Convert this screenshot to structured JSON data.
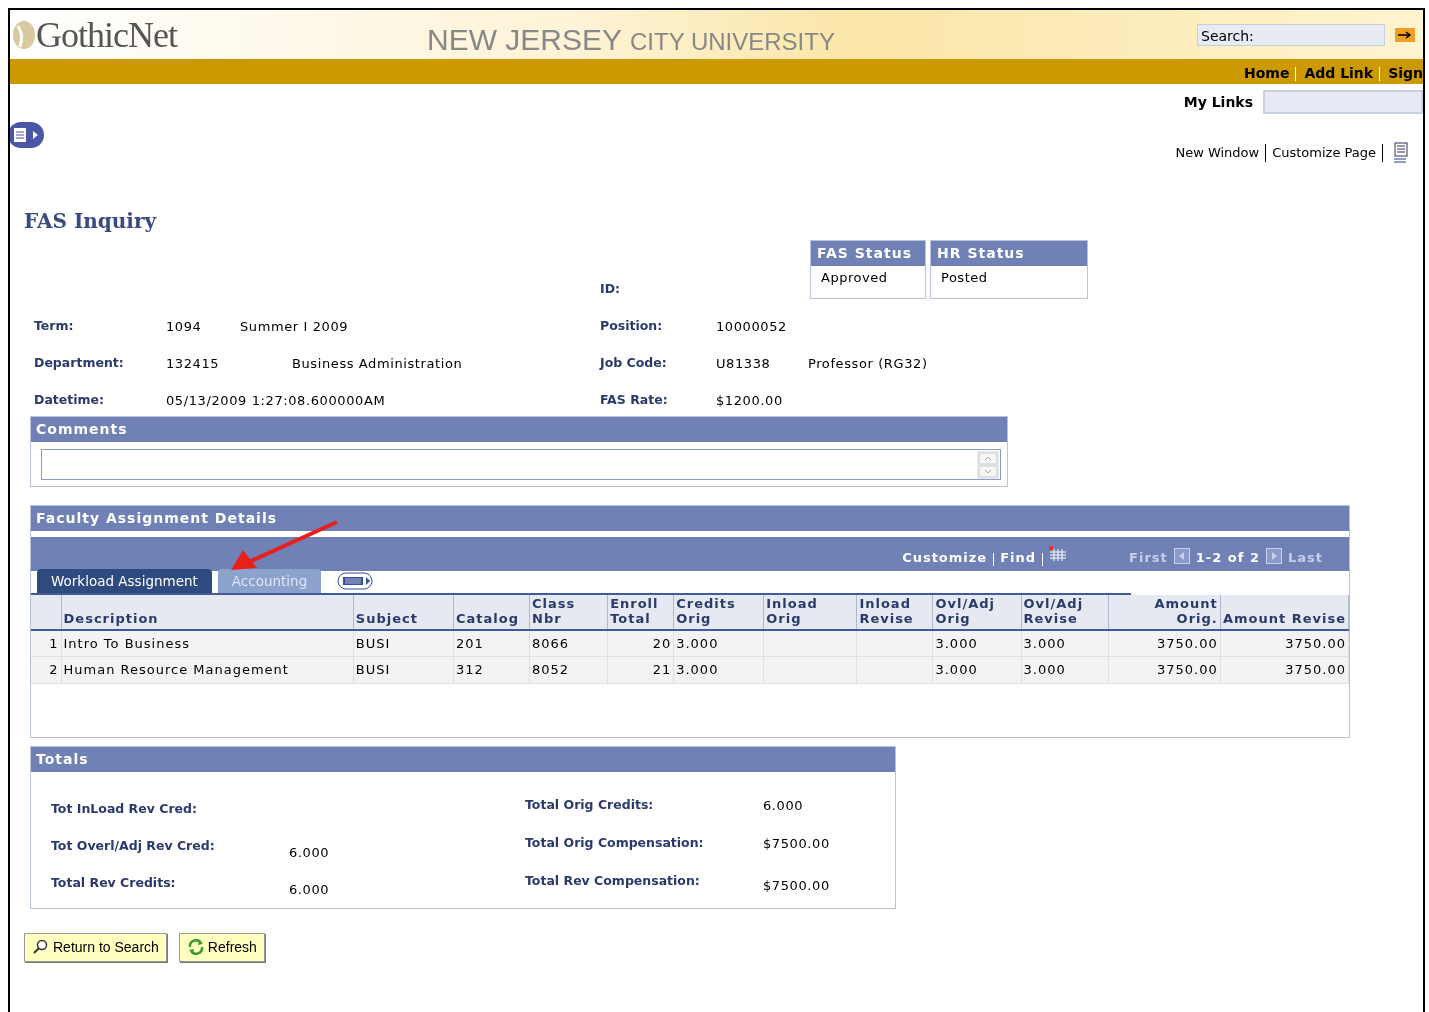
{
  "header": {
    "logo": "GothicNet",
    "university_main": "NEW JERSEY",
    "university_sub": "CITY UNIVERSITY",
    "search_label": "Search:"
  },
  "nav_links": [
    "Home",
    "Add Link",
    "Sign"
  ],
  "my_links": "My Links",
  "page_links": [
    "New Window",
    "Customize Page"
  ],
  "title": "FAS Inquiry",
  "status": [
    {
      "header": "FAS Status",
      "value": "Approved"
    },
    {
      "header": "HR Status",
      "value": "Posted"
    }
  ],
  "id_label": "ID:",
  "fields_left": [
    {
      "label": "Term:",
      "values": [
        "1094",
        "Summer I 2009"
      ]
    },
    {
      "label": "Department:",
      "values": [
        "132415",
        "Business Administration"
      ]
    },
    {
      "label": "Datetime:",
      "values": [
        "05/13/2009  1:27:08.600000AM"
      ]
    }
  ],
  "fields_right": [
    {
      "label": "Position:",
      "values": [
        "10000052"
      ]
    },
    {
      "label": "Job Code:",
      "values": [
        "U81338",
        "Professor (RG32)"
      ]
    },
    {
      "label": "FAS Rate:",
      "values": [
        "$1200.00"
      ]
    }
  ],
  "comments": {
    "title": "Comments"
  },
  "assignments": {
    "title": "Faculty Assignment Details",
    "toolbar_links": [
      "Customize",
      "Find"
    ],
    "first": "First",
    "range": "1-2 of 2",
    "last": "Last",
    "tabs": [
      {
        "label": "Workload Assignment",
        "selected": true
      },
      {
        "label": "Accounting",
        "selected": false
      }
    ],
    "columns": [
      "",
      "Description",
      "Subject",
      "Catalog",
      "Class Nbr",
      "Enroll Total",
      "Credits Orig",
      "Inload Orig",
      "Inload Revise",
      "Ovl/Adj Orig",
      "Ovl/Adj Revise",
      "Amount Orig.",
      "Amount Revise"
    ],
    "rows": [
      [
        "1",
        "Intro To Business",
        "BUSI",
        "201",
        "8066",
        "20",
        "3.000",
        "",
        "",
        "3.000",
        "3.000",
        "3750.00",
        "3750.00"
      ],
      [
        "2",
        "Human Resource Management",
        "BUSI",
        "312",
        "8052",
        "21",
        "3.000",
        "",
        "",
        "3.000",
        "3.000",
        "3750.00",
        "3750.00"
      ]
    ]
  },
  "totals": {
    "title": "Totals",
    "left": [
      {
        "label": "Tot InLoad Rev Cred:"
      },
      {
        "label": "Tot Overl/Adj Rev Cred:",
        "value": "6.000"
      },
      {
        "label": "Total Rev Credits:",
        "value": "6.000"
      }
    ],
    "right": [
      {
        "label": "Total Orig Credits:",
        "value": "6.000"
      },
      {
        "label": "Total Orig Compensation:",
        "value": "$7500.00"
      },
      {
        "label": "Total Rev Compensation:",
        "value": "$7500.00"
      }
    ]
  },
  "buttons": [
    {
      "label": "Return to Search",
      "kind": "search"
    },
    {
      "label": "Refresh",
      "kind": "refresh"
    }
  ]
}
